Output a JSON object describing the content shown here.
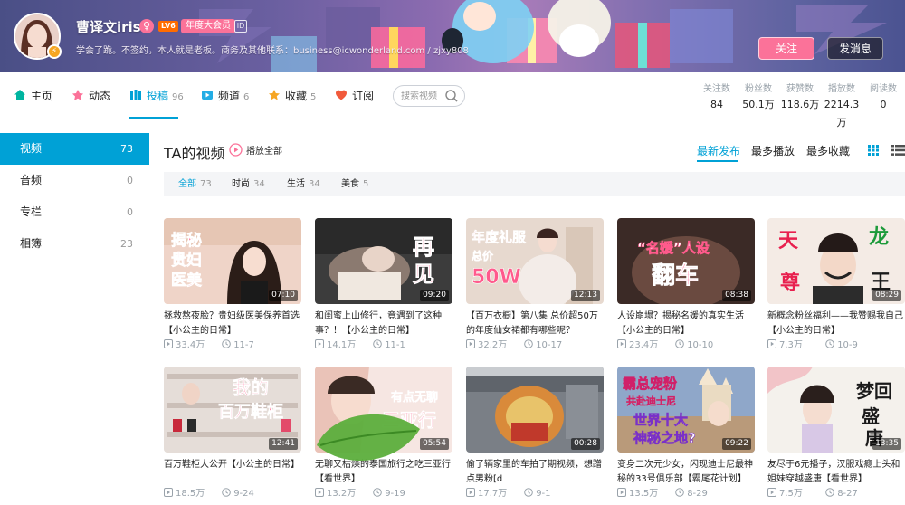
{
  "profile": {
    "username": "曹译文iris",
    "sex_icon": "♀",
    "level": "LV6",
    "vip_label": "年度大会员",
    "extra_badge": "ID",
    "avatar_badge": "⚡",
    "sign": "学会了跪。不签约，本人就是老板。商务及其他联系：business@icwonderland.com / zjxy808",
    "follow_label": "关注",
    "message_label": "发消息"
  },
  "nav": {
    "items": [
      {
        "label": "主页",
        "count": ""
      },
      {
        "label": "动态",
        "count": ""
      },
      {
        "label": "投稿",
        "count": "96"
      },
      {
        "label": "频道",
        "count": "6"
      },
      {
        "label": "收藏",
        "count": "5"
      },
      {
        "label": "订阅",
        "count": ""
      }
    ],
    "search_placeholder": "搜索视频"
  },
  "stats": [
    {
      "label": "关注数",
      "value": "84"
    },
    {
      "label": "粉丝数",
      "value": "50.1万"
    },
    {
      "label": "获赞数",
      "value": "118.6万"
    },
    {
      "label": "播放数",
      "value": "2214.3万"
    },
    {
      "label": "阅读数",
      "value": "0"
    }
  ],
  "sidebar": {
    "items": [
      {
        "label": "视频",
        "count": "73"
      },
      {
        "label": "音频",
        "count": "0"
      },
      {
        "label": "专栏",
        "count": "0"
      },
      {
        "label": "相簿",
        "count": "23"
      }
    ]
  },
  "main": {
    "title": "TA的视频",
    "play_all": "播放全部",
    "sort": [
      "最新发布",
      "最多播放",
      "最多收藏"
    ],
    "filters": [
      {
        "label": "全部",
        "count": "73"
      },
      {
        "label": "时尚",
        "count": "34"
      },
      {
        "label": "生活",
        "count": "34"
      },
      {
        "label": "美食",
        "count": "5"
      }
    ]
  },
  "videos": [
    {
      "title": "拯救熬夜脸？贵妇级医美保养首选【小公主的日常】",
      "duration": "07:10",
      "views": "33.4万",
      "date": "11-7",
      "overlay": "揭秘贵妇医美"
    },
    {
      "title": "和闺蜜上山修行，竟遇到了这种事？！【小公主的日常】",
      "duration": "09:20",
      "views": "14.1万",
      "date": "11-1",
      "overlay": "再见"
    },
    {
      "title": "【百万衣橱】第八集 总价超50万的年度仙女裙都有哪些呢？",
      "duration": "12:13",
      "views": "32.2万",
      "date": "10-17",
      "overlay": "年度礼服 总价 50W"
    },
    {
      "title": "人设崩塌？揭秘名媛的真实生活【小公主的日常】",
      "duration": "08:38",
      "views": "23.4万",
      "date": "10-10",
      "overlay": "“名媛”人设 翻车"
    },
    {
      "title": "新概念粉丝福利——我赞赐我自己【小公主的日常】",
      "duration": "08:29",
      "views": "7.3万",
      "date": "10-9",
      "overlay": "天 龙 尊 王"
    },
    {
      "title": "百万鞋柜大公开【小公主的日常】",
      "duration": "12:41",
      "views": "18.5万",
      "date": "9-24",
      "overlay": "我的百万鞋柜"
    },
    {
      "title": "无聊又枯燥的泰国旅行之吃三亚行【看世界】",
      "duration": "05:54",
      "views": "13.2万",
      "date": "9-19",
      "overlay": "有点无聊 三亚行"
    },
    {
      "title": "偷了辆家里的车拍了期视频，想蹭点男粉[d",
      "duration": "00:28",
      "views": "17.7万",
      "date": "9-1",
      "overlay": ""
    },
    {
      "title": "变身二次元少女，闪现迪士尼最神秘的33号俱乐部【霸尾花计划】",
      "duration": "09:22",
      "views": "13.5万",
      "date": "8-29",
      "overlay": "霸总宠粉 共赴迪士尼 世界十大 神秘之地?"
    },
    {
      "title": "友尽于6元播子，汉服戏瘾上头和姐妹穿越盛唐【看世界】",
      "duration": "13:35",
      "views": "7.5万",
      "date": "8-27",
      "overlay": "梦回盛唐"
    }
  ],
  "colors": {
    "accent": "#00a1d6",
    "pink": "#fb7299",
    "muted": "#99a2aa"
  }
}
